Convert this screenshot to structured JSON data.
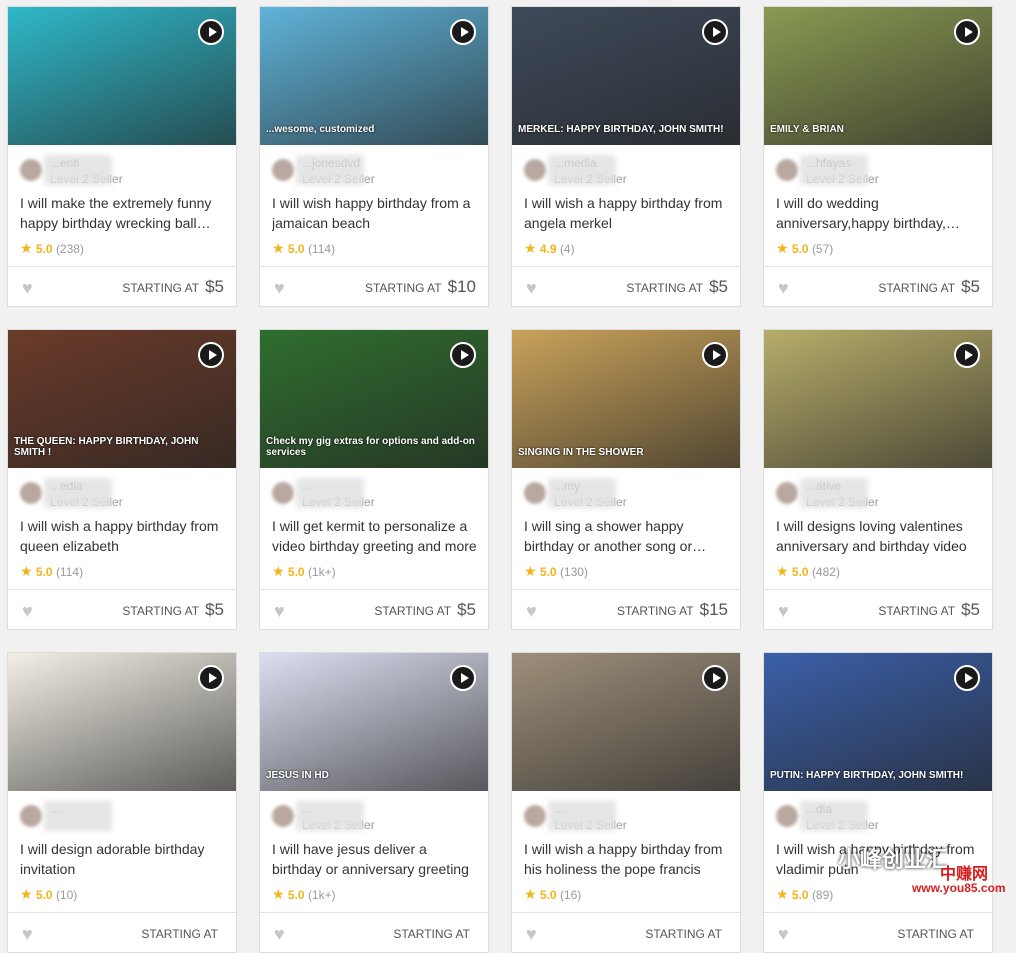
{
  "starting_label": "STARTING AT",
  "gigs": [
    {
      "seller": "...enti",
      "level": "Level 2 Seller",
      "title": "I will make the extremely funny happy birthday wrecking ball video",
      "rating": "5.0",
      "count": "(238)",
      "price": "$5",
      "thumb_bg": "#2fb8c9",
      "thumb_text": ""
    },
    {
      "seller": "...jonesdvd",
      "level": "Level 2 Seller",
      "title": "I will wish happy birthday from a jamaican beach",
      "rating": "5.0",
      "count": "(114)",
      "price": "$10",
      "thumb_bg": "#5fb3d9",
      "thumb_text": "...wesome, customized"
    },
    {
      "seller": "...media",
      "level": "Level 2 Seller",
      "title": "I will wish a happy birthday from angela merkel",
      "rating": "4.9",
      "count": "(4)",
      "price": "$5",
      "thumb_bg": "#3e4a5a",
      "thumb_text": "MERKEL: HAPPY BIRTHDAY, JOHN SMITH!"
    },
    {
      "seller": "...hfayas",
      "level": "Level 2 Seller",
      "title": "I will do wedding anniversary,happy birthday, greeting video",
      "rating": "5.0",
      "count": "(57)",
      "price": "$5",
      "thumb_bg": "#8a9a52",
      "thumb_text": "EMILY & BRIAN"
    },
    {
      "seller": "...edia",
      "level": "Level 2 Seller",
      "title": "I will wish a happy birthday from queen elizabeth",
      "rating": "5.0",
      "count": "(114)",
      "price": "$5",
      "thumb_bg": "#6b3b2a",
      "thumb_text": "THE QUEEN: HAPPY BIRTHDAY, JOHN SMITH !"
    },
    {
      "seller": "...",
      "level": "Level 2 Seller",
      "title": "I will get kermit to personalize a video birthday greeting and more",
      "rating": "5.0",
      "count": "(1k+)",
      "price": "$5",
      "thumb_bg": "#2f6e2f",
      "thumb_text": "Check my gig extras for options and add-on services"
    },
    {
      "seller": "...my",
      "level": "Level 2 Seller",
      "title": "I will sing a shower happy birthday or another song or greeting",
      "rating": "5.0",
      "count": "(130)",
      "price": "$15",
      "thumb_bg": "#c9a25a",
      "thumb_text": "SINGING IN THE SHOWER"
    },
    {
      "seller": "...ative",
      "level": "Level 2 Seller",
      "title": "I will designs loving valentines anniversary and birthday video",
      "rating": "5.0",
      "count": "(482)",
      "price": "$5",
      "thumb_bg": "#b7ad6a",
      "thumb_text": ""
    },
    {
      "seller": "...",
      "level": "",
      "title": "I will design adorable birthday invitation",
      "rating": "5.0",
      "count": "(10)",
      "price": "",
      "thumb_bg": "#f3efe6",
      "thumb_text": ""
    },
    {
      "seller": "...",
      "level": "Level 2 Seller",
      "title": "I will have jesus deliver a birthday or anniversary greeting",
      "rating": "5.0",
      "count": "(1k+)",
      "price": "",
      "thumb_bg": "#dcdff0",
      "thumb_text": "JESUS IN HD"
    },
    {
      "seller": "...",
      "level": "Level 2 Seller",
      "title": "I will wish a happy birthday from his holiness the pope francis",
      "rating": "5.0",
      "count": "(16)",
      "price": "",
      "thumb_bg": "#9d8f7a",
      "thumb_text": ""
    },
    {
      "seller": "...dia",
      "level": "Level 2 Seller",
      "title": "I will wish a happy birthday from vladimir putin",
      "rating": "5.0",
      "count": "(89)",
      "price": "",
      "thumb_bg": "#3b5fa8",
      "thumb_text": "PUTIN: HAPPY BIRTHDAY, JOHN SMITH!"
    }
  ],
  "watermark": {
    "brand": "小峰创业汇",
    "site": "www.you85.com",
    "logo": "中赚网"
  }
}
